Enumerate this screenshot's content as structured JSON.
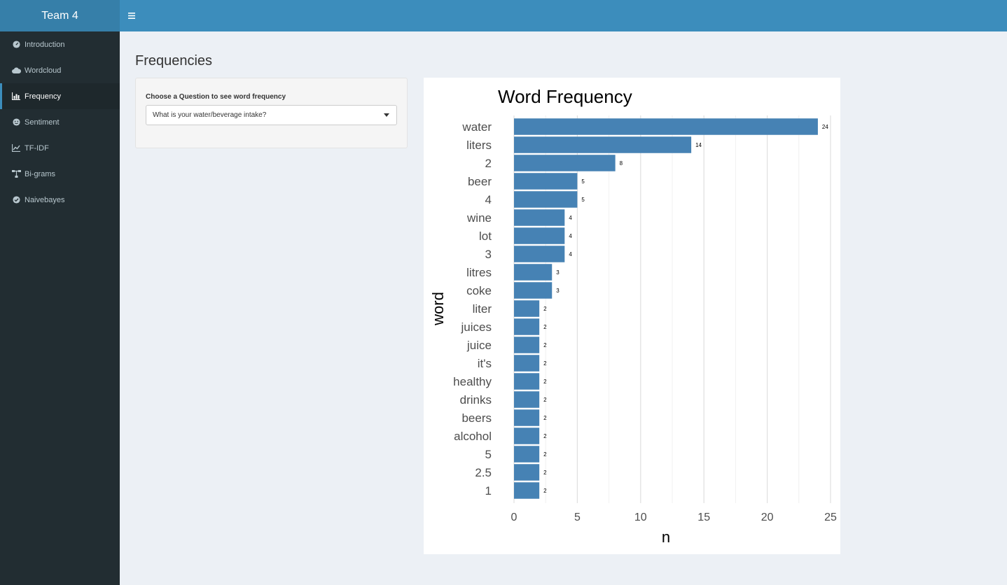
{
  "header": {
    "brand": "Team 4",
    "menu_icon": "hamburger-icon"
  },
  "sidebar": {
    "items": [
      {
        "label": "Introduction",
        "icon": "dashboard-icon"
      },
      {
        "label": "Wordcloud",
        "icon": "cloud-icon"
      },
      {
        "label": "Frequency",
        "icon": "bar-chart-icon",
        "active": true
      },
      {
        "label": "Sentiment",
        "icon": "smile-icon"
      },
      {
        "label": "TF-IDF",
        "icon": "line-chart-icon"
      },
      {
        "label": "Bi-grams",
        "icon": "sitemap-icon"
      },
      {
        "label": "Naivebayes",
        "icon": "check-circle-icon"
      }
    ]
  },
  "main": {
    "title": "Frequencies",
    "question_box": {
      "label": "Choose a Question to see word frequency",
      "selected": "What is your water/beverage intake?"
    }
  },
  "colors": {
    "bar": "#4682b4",
    "header": "#3c8dbc",
    "sidebar": "#222d32"
  },
  "chart_data": {
    "type": "bar",
    "orientation": "horizontal",
    "title": "Word Frequency",
    "xlabel": "n",
    "ylabel": "word",
    "xlim": [
      0,
      25
    ],
    "x_ticks": [
      0,
      5,
      10,
      15,
      20,
      25
    ],
    "grid": true,
    "categories": [
      "water",
      "liters",
      "2",
      "beer",
      "4",
      "wine",
      "lot",
      "3",
      "litres",
      "coke",
      "liter",
      "juices",
      "juice",
      "it's",
      "healthy",
      "drinks",
      "beers",
      "alcohol",
      "5",
      "2.5",
      "1"
    ],
    "values": [
      24,
      14,
      8,
      5,
      5,
      4,
      4,
      4,
      3,
      3,
      2,
      2,
      2,
      2,
      2,
      2,
      2,
      2,
      2,
      2,
      2
    ]
  }
}
